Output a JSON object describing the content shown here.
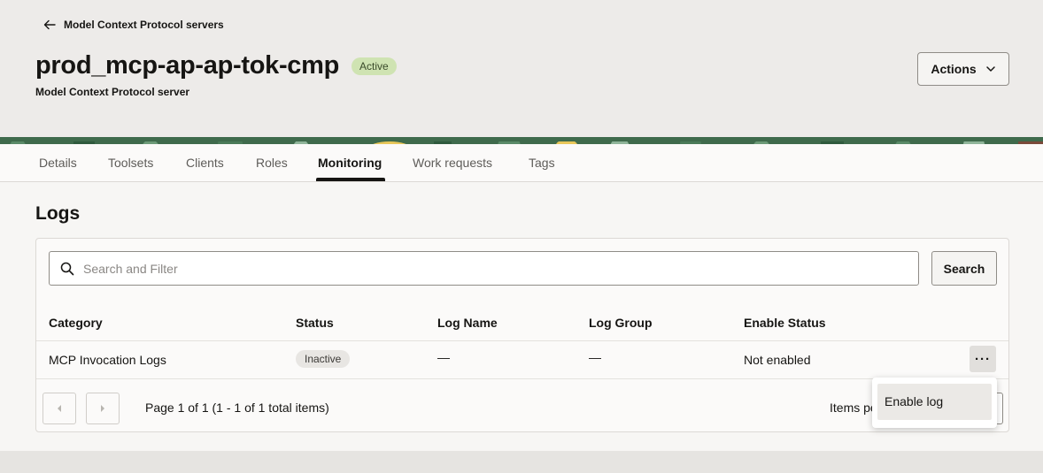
{
  "header": {
    "back_label": "Model Context Protocol servers",
    "title": "prod_mcp-ap-ap-tok-cmp",
    "status": "Active",
    "subtitle": "Model Context Protocol server",
    "actions_label": "Actions"
  },
  "tabs": [
    {
      "label": "Details"
    },
    {
      "label": "Toolsets"
    },
    {
      "label": "Clients"
    },
    {
      "label": "Roles"
    },
    {
      "label": "Monitoring",
      "active": true
    },
    {
      "label": "Work requests"
    },
    {
      "label": "Tags"
    }
  ],
  "logs": {
    "title": "Logs",
    "search_placeholder": "Search and Filter",
    "search_button": "Search",
    "columns": [
      "Category",
      "Status",
      "Log Name",
      "Log Group",
      "Enable Status"
    ],
    "rows": [
      {
        "category": "MCP Invocation Logs",
        "status": "Inactive",
        "log_name": "—",
        "log_group": "—",
        "enable_status": "Not enabled"
      }
    ],
    "pagination": {
      "text": "Page 1 of 1 (1 - 1 of 1 total items)",
      "items_per_page_label": "Items pe"
    }
  },
  "row_menu": {
    "items": [
      "Enable log"
    ]
  },
  "colors": {
    "active_badge": "#cfe3b2",
    "inactive_badge": "#e8e6e3",
    "header_bg": "#edebe9",
    "banner_green": "#3f6a4c",
    "banner_yellow": "#e8c75a"
  },
  "icons": {
    "back": "arrow-left-icon",
    "actions": "chevron-down-icon",
    "search": "search-icon",
    "row_actions": "more-actions-icon",
    "prev": "prev-page-icon",
    "next": "next-page-icon"
  }
}
